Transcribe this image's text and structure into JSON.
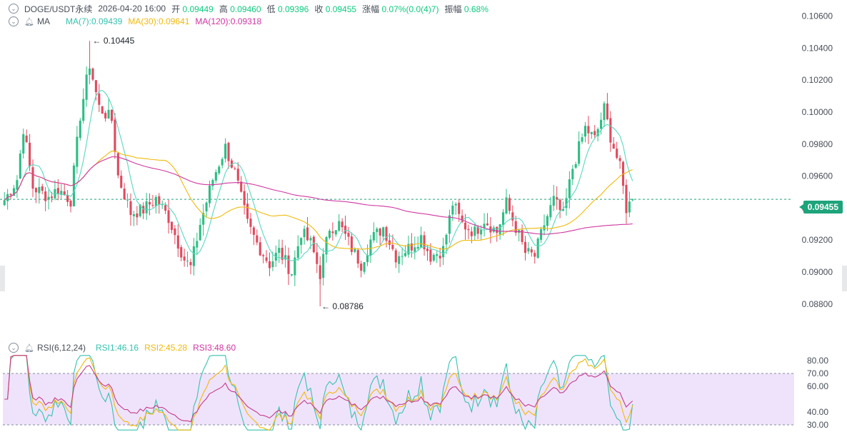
{
  "header": {
    "symbol": "DOGE/USDT永续",
    "datetime": "2026-04-20 16:00",
    "open_label": "开",
    "open": "0.09449",
    "high_label": "高",
    "high": "0.09460",
    "low_label": "低",
    "low": "0.09396",
    "close_label": "收",
    "close": "0.09455",
    "change_label": "涨幅",
    "change": "0.07%(0.0(4)7)",
    "amplitude_label": "振幅",
    "amplitude": "0.68%"
  },
  "ma_legend": {
    "name": "MA",
    "ma7": "MA(7):0.09439",
    "ma30": "MA(30):0.09641",
    "ma120": "MA(120):0.09318"
  },
  "rsi_legend": {
    "name": "RSI(6,12,24)",
    "rsi1": "RSI1:46.16",
    "rsi2": "RSI2:45.28",
    "rsi3": "RSI3:48.60"
  },
  "colors": {
    "up": "#2ebd85",
    "down": "#e04a5f",
    "ma7": "#5ad8c0",
    "ma30": "#f0b90b",
    "ma120": "#d0359f",
    "rsi1": "#36c2b0",
    "rsi2": "#f0b90b",
    "rsi3": "#c43b8b",
    "rsi_band": "#efe3fb",
    "axis_text": "#474d57"
  },
  "chart_data": [
    {
      "type": "candlestick",
      "title": "DOGE/USDT永续",
      "y_ticks": [
        "0.10600",
        "0.10400",
        "0.10200",
        "0.10000",
        "0.09800",
        "0.09600",
        "0.09400",
        "0.09200",
        "0.09000",
        "0.08800"
      ],
      "ylim": [
        0.0867,
        0.1062
      ],
      "current_price": "0.09455",
      "annotations": {
        "high": "0.10445",
        "low": "0.08786",
        "high_value": 0.10445,
        "low_value": 0.08786
      },
      "candle_count": 200,
      "anchors": [
        [
          0,
          0.0945
        ],
        [
          4,
          0.0958
        ],
        [
          6,
          0.099
        ],
        [
          9,
          0.0953
        ],
        [
          14,
          0.0947
        ],
        [
          17,
          0.0952
        ],
        [
          21,
          0.0945
        ],
        [
          24,
          0.0998
        ],
        [
          27,
          0.103
        ],
        [
          30,
          0.1003
        ],
        [
          34,
          0.0995
        ],
        [
          36,
          0.096
        ],
        [
          40,
          0.0937
        ],
        [
          44,
          0.0939
        ],
        [
          48,
          0.0946
        ],
        [
          52,
          0.0934
        ],
        [
          57,
          0.0908
        ],
        [
          59,
          0.0903
        ],
        [
          62,
          0.093
        ],
        [
          66,
          0.0958
        ],
        [
          70,
          0.0978
        ],
        [
          73,
          0.0962
        ],
        [
          77,
          0.093
        ],
        [
          80,
          0.0918
        ],
        [
          84,
          0.0905
        ],
        [
          87,
          0.0913
        ],
        [
          91,
          0.09
        ],
        [
          94,
          0.0925
        ],
        [
          97,
          0.0918
        ],
        [
          100,
          0.0899
        ],
        [
          103,
          0.0928
        ],
        [
          106,
          0.093
        ],
        [
          110,
          0.0915
        ],
        [
          113,
          0.0905
        ],
        [
          116,
          0.092
        ],
        [
          120,
          0.0928
        ],
        [
          124,
          0.091
        ],
        [
          128,
          0.0915
        ],
        [
          132,
          0.0922
        ],
        [
          135,
          0.091
        ],
        [
          139,
          0.0914
        ],
        [
          142,
          0.0943
        ],
        [
          145,
          0.093
        ],
        [
          149,
          0.0925
        ],
        [
          152,
          0.0933
        ],
        [
          156,
          0.0925
        ],
        [
          159,
          0.0943
        ],
        [
          162,
          0.0928
        ],
        [
          165,
          0.0912
        ],
        [
          168,
          0.091
        ],
        [
          171,
          0.093
        ],
        [
          174,
          0.0945
        ],
        [
          177,
          0.0935
        ],
        [
          180,
          0.0965
        ],
        [
          184,
          0.099
        ],
        [
          187,
          0.0983
        ],
        [
          190,
          0.1002
        ],
        [
          192,
          0.0985
        ],
        [
          195,
          0.0965
        ],
        [
          197,
          0.094
        ],
        [
          199,
          0.0945
        ]
      ],
      "ma7_end": 0.09439,
      "ma30_end": 0.09641,
      "ma120_end": 0.09318
    },
    {
      "type": "line",
      "title": "RSI(6,12,24)",
      "y_ticks": [
        "80.00",
        "70.00",
        "60.00",
        "40.00",
        "30.00"
      ],
      "band": [
        30,
        70
      ],
      "series": [
        {
          "name": "RSI1",
          "last": 46.16
        },
        {
          "name": "RSI2",
          "last": 45.28
        },
        {
          "name": "RSI3",
          "last": 48.6
        }
      ]
    }
  ]
}
